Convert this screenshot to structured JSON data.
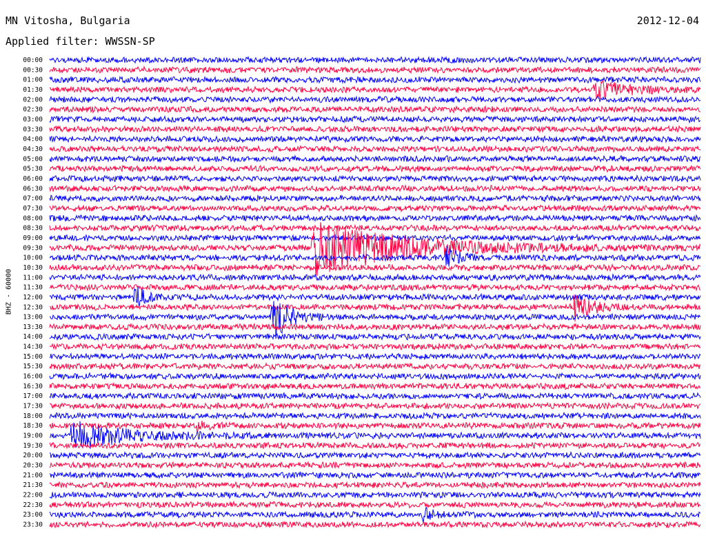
{
  "header": {
    "station": "MN Vitosha, Bulgaria",
    "date": "2012-12-04",
    "filter": "Applied filter: WWSSN-SP"
  },
  "colors": {
    "trace_a": "#0000ff",
    "trace_b": "#ff0040",
    "text": "#000000"
  },
  "chart_data": {
    "type": "line",
    "subtype": "helicorder",
    "ylabel": "BHZ - 60000",
    "row_labels": [
      "00:00",
      "00:30",
      "01:00",
      "01:30",
      "02:00",
      "02:30",
      "03:00",
      "03:30",
      "04:00",
      "04:30",
      "05:00",
      "05:30",
      "06:00",
      "06:30",
      "07:00",
      "07:30",
      "08:00",
      "08:30",
      "09:00",
      "09:30",
      "10:00",
      "10:30",
      "11:00",
      "11:30",
      "12:00",
      "12:30",
      "13:00",
      "13:30",
      "14:00",
      "14:30",
      "15:00",
      "15:30",
      "16:00",
      "16:30",
      "17:00",
      "17:30",
      "18:00",
      "18:30",
      "19:00",
      "19:30",
      "20:00",
      "20:30",
      "21:00",
      "21:30",
      "22:00",
      "22:30",
      "23:00",
      "23:30"
    ],
    "row_duration_min": 30,
    "series_colors_alternating": [
      "blue",
      "red"
    ],
    "grid": false,
    "events": [
      {
        "row": "01:30",
        "minute": 25.2,
        "peak": 12,
        "decay": 2.0,
        "color": "red"
      },
      {
        "row": "09:30",
        "minute": 12.2,
        "peak": 40,
        "decay": 6.0,
        "color": "red"
      },
      {
        "row": "10:00",
        "minute": 18.3,
        "peak": 14,
        "decay": 0.6,
        "color": "blue"
      },
      {
        "row": "12:00",
        "minute": 4.0,
        "peak": 14,
        "decay": 0.6,
        "color": "blue"
      },
      {
        "row": "12:30",
        "minute": 24.3,
        "peak": 18,
        "decay": 0.8,
        "color": "red"
      },
      {
        "row": "13:00",
        "minute": 10.3,
        "peak": 36,
        "decay": 0.8,
        "color": "blue"
      },
      {
        "row": "18:30",
        "minute": 6.9,
        "peak": 6,
        "decay": 0.4,
        "color": "red"
      },
      {
        "row": "19:00",
        "minute": 1.1,
        "peak": 20,
        "decay": 3.5,
        "color": "blue"
      },
      {
        "row": "23:00",
        "minute": 17.3,
        "peak": 8,
        "decay": 0.4,
        "color": "blue"
      }
    ]
  }
}
